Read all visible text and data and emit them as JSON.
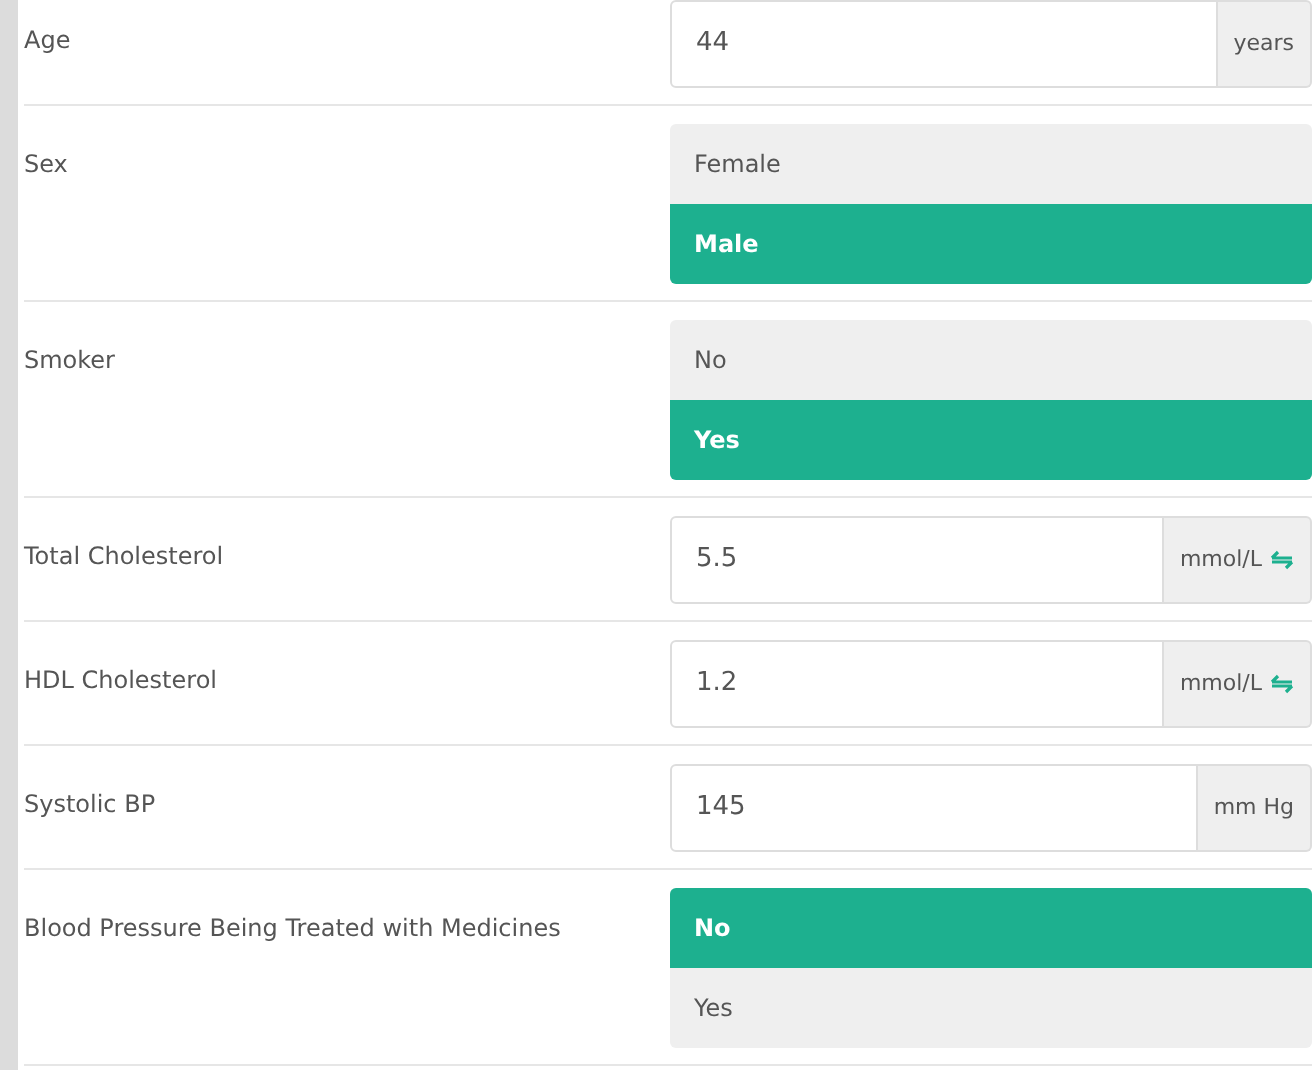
{
  "fields": [
    {
      "kind": "number",
      "label": "Age",
      "value": "44",
      "unit": "years",
      "convertible": false
    },
    {
      "kind": "choice",
      "label": "Sex",
      "options": [
        {
          "label": "Female",
          "selected": false
        },
        {
          "label": "Male",
          "selected": true
        }
      ]
    },
    {
      "kind": "choice",
      "label": "Smoker",
      "options": [
        {
          "label": "No",
          "selected": false
        },
        {
          "label": "Yes",
          "selected": true
        }
      ]
    },
    {
      "kind": "number",
      "label": "Total Cholesterol",
      "value": "5.5",
      "unit": "mmol/L",
      "convertible": true
    },
    {
      "kind": "number",
      "label": "HDL Cholesterol",
      "value": "1.2",
      "unit": "mmol/L",
      "convertible": true
    },
    {
      "kind": "number",
      "label": "Systolic BP",
      "value": "145",
      "unit": "mm Hg",
      "convertible": false
    },
    {
      "kind": "choice",
      "label": "Blood Pressure Being Treated with Medicines",
      "options": [
        {
          "label": "No",
          "selected": true
        },
        {
          "label": "Yes",
          "selected": false
        }
      ]
    }
  ]
}
